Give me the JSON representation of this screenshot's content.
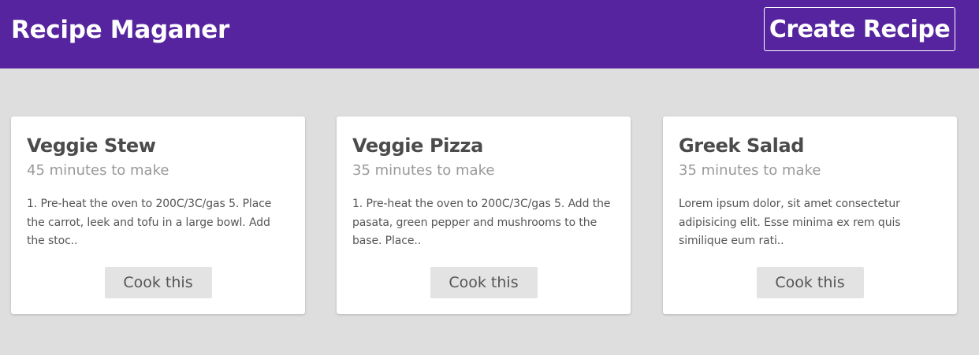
{
  "header": {
    "brand": "Recipe Maganer",
    "create_button": "Create Recipe"
  },
  "recipes": [
    {
      "title": "Veggie Stew",
      "time": "45 minutes to make",
      "description": "1. Pre-heat the oven to 200C/3C/gas 5. Place the carrot, leek and tofu in a large bowl. Add the stoc..",
      "button": "Cook this"
    },
    {
      "title": "Veggie Pizza",
      "time": "35 minutes to make",
      "description": "1. Pre-heat the oven to 200C/3C/gas 5. Add the pasata, green pepper and mushrooms to the base. Place..",
      "button": "Cook this"
    },
    {
      "title": "Greek Salad",
      "time": "35 minutes to make",
      "description": "Lorem ipsum dolor, sit amet consectetur adipisicing elit. Esse minima ex rem quis similique eum rati..",
      "button": "Cook this"
    }
  ],
  "colors": {
    "header_bg": "#56249e",
    "page_bg": "#dedede",
    "card_bg": "#ffffff",
    "button_bg": "#e3e3e3"
  }
}
